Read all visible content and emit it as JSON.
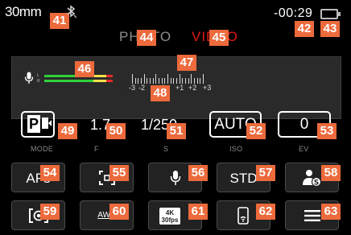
{
  "status": {
    "focal_length": "30mm",
    "bluetooth_icon": "bluetooth-off-icon",
    "timer": "-00:29",
    "battery_icon": "battery-icon"
  },
  "tabs": {
    "photo": "PHOTO",
    "video": "VIDEO",
    "active": "video"
  },
  "audio": {
    "channel_labels": [
      "L",
      "R"
    ],
    "level_bars": [
      {
        "label": "L",
        "level": 0.95
      },
      {
        "label": "R",
        "level": 0.95
      }
    ]
  },
  "exposure_scale": {
    "labels": [
      "-3",
      "-2",
      "0",
      "+1",
      "+2",
      "+3"
    ]
  },
  "settings": {
    "mode": {
      "value": "P",
      "label": "MODE"
    },
    "aperture": {
      "value": "1.7",
      "label": "F"
    },
    "shutter": {
      "value": "1/250",
      "label": "S"
    },
    "iso": {
      "value": "AUTO",
      "label": "ISO"
    },
    "ev": {
      "value": "0",
      "label": "EV"
    }
  },
  "buttons": [
    {
      "label": "AFs"
    },
    {
      "icon": "focus-field-icon"
    },
    {
      "icon": "microphone-icon"
    },
    {
      "label": "STD"
    },
    {
      "icon": "user-profile-icon"
    },
    {
      "icon": "metering-icon"
    },
    {
      "label": "AWB"
    },
    {
      "label": "4K 30fps",
      "icon": "video-format-icon"
    },
    {
      "icon": "phone-connect-icon"
    },
    {
      "icon": "menu-icon"
    }
  ],
  "callouts": [
    "41",
    "42",
    "43",
    "44",
    "45",
    "46",
    "47",
    "48",
    "49",
    "50",
    "51",
    "52",
    "53",
    "54",
    "55",
    "56",
    "57",
    "58",
    "59",
    "60",
    "61",
    "62",
    "63"
  ],
  "colors": {
    "accent": "#ec6a3c",
    "video_active": "#e81818",
    "meter_green": "#2fd13a",
    "meter_yellow": "#f2e14a",
    "meter_red": "#e42a2a"
  }
}
